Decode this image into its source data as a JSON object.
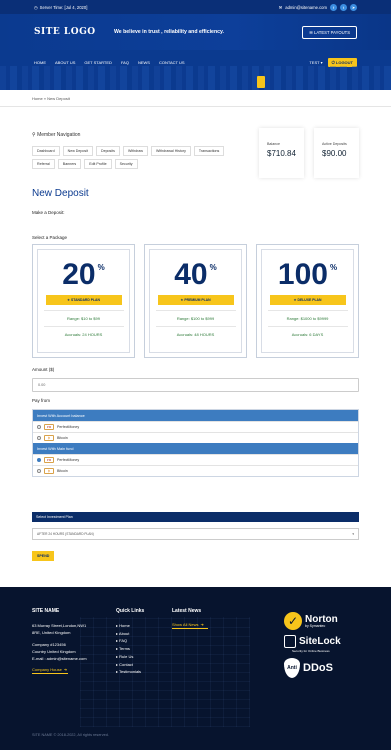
{
  "topbar": {
    "server_time": "Server Time: [Jul 4, 2020]",
    "email": "admin@sitename.com",
    "social": [
      "f",
      "t",
      "tg"
    ]
  },
  "header": {
    "logo": "SITE LOGO",
    "tagline": "We believe in trust , reliability and efficiency.",
    "payouts_button": "LATEST PAYOUTS"
  },
  "nav": {
    "items": [
      "HOME",
      "ABOUT US",
      "GET STARTED",
      "FAQ",
      "NEWS",
      "CONTACT US"
    ],
    "test_label": "TEST",
    "logout": "LOGOUT"
  },
  "breadcrumb": {
    "home": "Home",
    "separator": "»",
    "current": "New Deposit"
  },
  "member": {
    "title": "Member Navigation",
    "links": [
      "Dashboard",
      "New Deposit",
      "Deposits",
      "Withdraw",
      "Withdrawal History",
      "Transactions",
      "Referral",
      "Banners",
      "Edit Profile",
      "Security"
    ],
    "balance_label": "Balance",
    "balance_value": "$710.84",
    "active_label": "Active Deposits",
    "active_value": "$90.00"
  },
  "deposit": {
    "title": "New Deposit",
    "make_label": "Make a Deposit:",
    "select_package": "Select a Package",
    "packages": [
      {
        "pct": "20",
        "name": "STANDARD PLAN",
        "range": "Range: $10 to $99",
        "accrual": "Accruals: 24 HOURS"
      },
      {
        "pct": "40",
        "name": "PREMIUM PLAN",
        "range": "Range: $100 to $999",
        "accrual": "Accruals: 48 HOURS"
      },
      {
        "pct": "100",
        "name": "DELUXE PLAN",
        "range": "Range: $1000 to $9999",
        "accrual": "Accruals: 6 DAYS"
      }
    ],
    "pct_symbol": "%",
    "amount_label": "Amount ($)",
    "amount_value": "0.00",
    "pay_from": "Pay from",
    "account_balance_head": "Invest With Account balance",
    "main_fund_head": "Invest With Main fund",
    "methods": [
      "PerfectMoney",
      "Bitcoin"
    ],
    "plan_head": "Select Investment Plan",
    "plan_selected": "AFTER 24 HOURS (STANDARD PLAN)",
    "spend": "SPEND"
  },
  "footer": {
    "site_name": "SITE NAME",
    "address1": "63 Murray Street,London,NW1",
    "address2": "8RE, United Kingdom",
    "company": "Company #123456",
    "country": "Country United Kingdom",
    "email": "E-mail : admin@sitename.com",
    "company_house": "Company House",
    "quick_links_title": "Quick Links",
    "quick_links": [
      "Home",
      "About",
      "FAQ",
      "Terms",
      "Rule Us",
      "Contact",
      "Testimonials"
    ],
    "news_title": "Latest News",
    "all_news": "Show All News",
    "norton": "Norton",
    "symantec": "by Symantec",
    "sitelock": "SiteLock",
    "sitelock_sub": "Security for Online Business",
    "anti": "Anti",
    "ddos": "DDoS",
    "copyright": "SITE NAME © 2018-2022, All rights reserved."
  }
}
